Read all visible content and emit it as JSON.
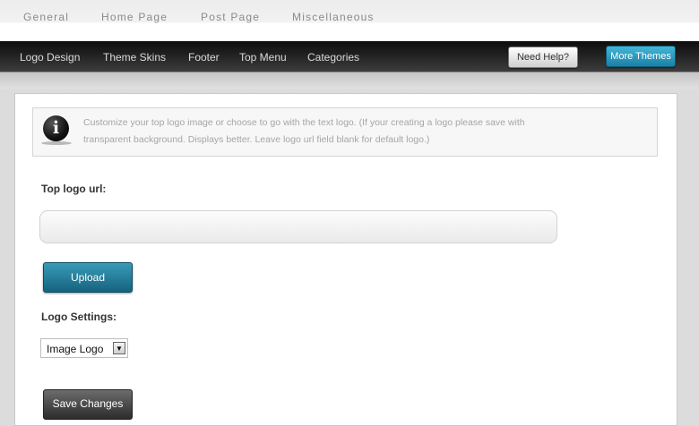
{
  "top_nav": [
    "General",
    "Home Page",
    "Post Page",
    "Miscellaneous"
  ],
  "sub_nav": [
    "Logo Design",
    "Theme Skins",
    "Footer",
    "Top Menu",
    "Categories"
  ],
  "buttons": {
    "help": "Need Help?",
    "more_themes": "More Themes",
    "upload": "Upload",
    "save": "Save Changes"
  },
  "info": {
    "icon": "info-icon",
    "glyph": "i",
    "line1": "Customize your top logo image or choose to go with the text logo. (If your creating a logo please save with",
    "line2": "transparent background. Displays better. Leave logo url field blank for default logo.)"
  },
  "form": {
    "logo_url_label": "Top logo url:",
    "logo_url_value": "",
    "logo_settings_label": "Logo Settings:",
    "logo_settings_selected": "Image Logo",
    "dropdown_glyph": "▼"
  },
  "colors": {
    "accent": "#1b7fa5",
    "nav_dark": "#1f1f1f"
  }
}
